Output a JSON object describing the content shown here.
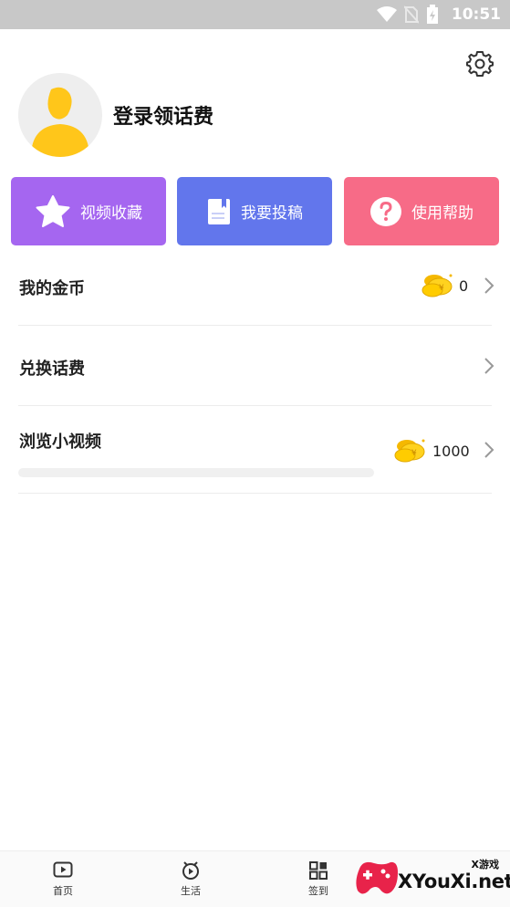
{
  "status_bar": {
    "time": "10:51"
  },
  "profile": {
    "login_label": "登录领话费"
  },
  "actions": [
    {
      "label": "视频收藏",
      "color": "#a566f0",
      "icon": "star-icon"
    },
    {
      "label": "我要投稿",
      "color": "#6276ec",
      "icon": "document-icon"
    },
    {
      "label": "使用帮助",
      "color": "#f76b87",
      "icon": "question-icon"
    }
  ],
  "rows": {
    "coins": {
      "label": "我的金币",
      "value": "0"
    },
    "exchange": {
      "label": "兑换话费"
    },
    "browse": {
      "label": "浏览小视频",
      "value": "1000",
      "progress": 0
    }
  },
  "bottom_nav": [
    {
      "label": "首页",
      "icon": "play-square-icon"
    },
    {
      "label": "生活",
      "icon": "play-circle-icon"
    },
    {
      "label": "签到",
      "icon": "grid-icon"
    }
  ],
  "watermark": {
    "sub": "X游戏",
    "main": "XYouXi.net"
  }
}
